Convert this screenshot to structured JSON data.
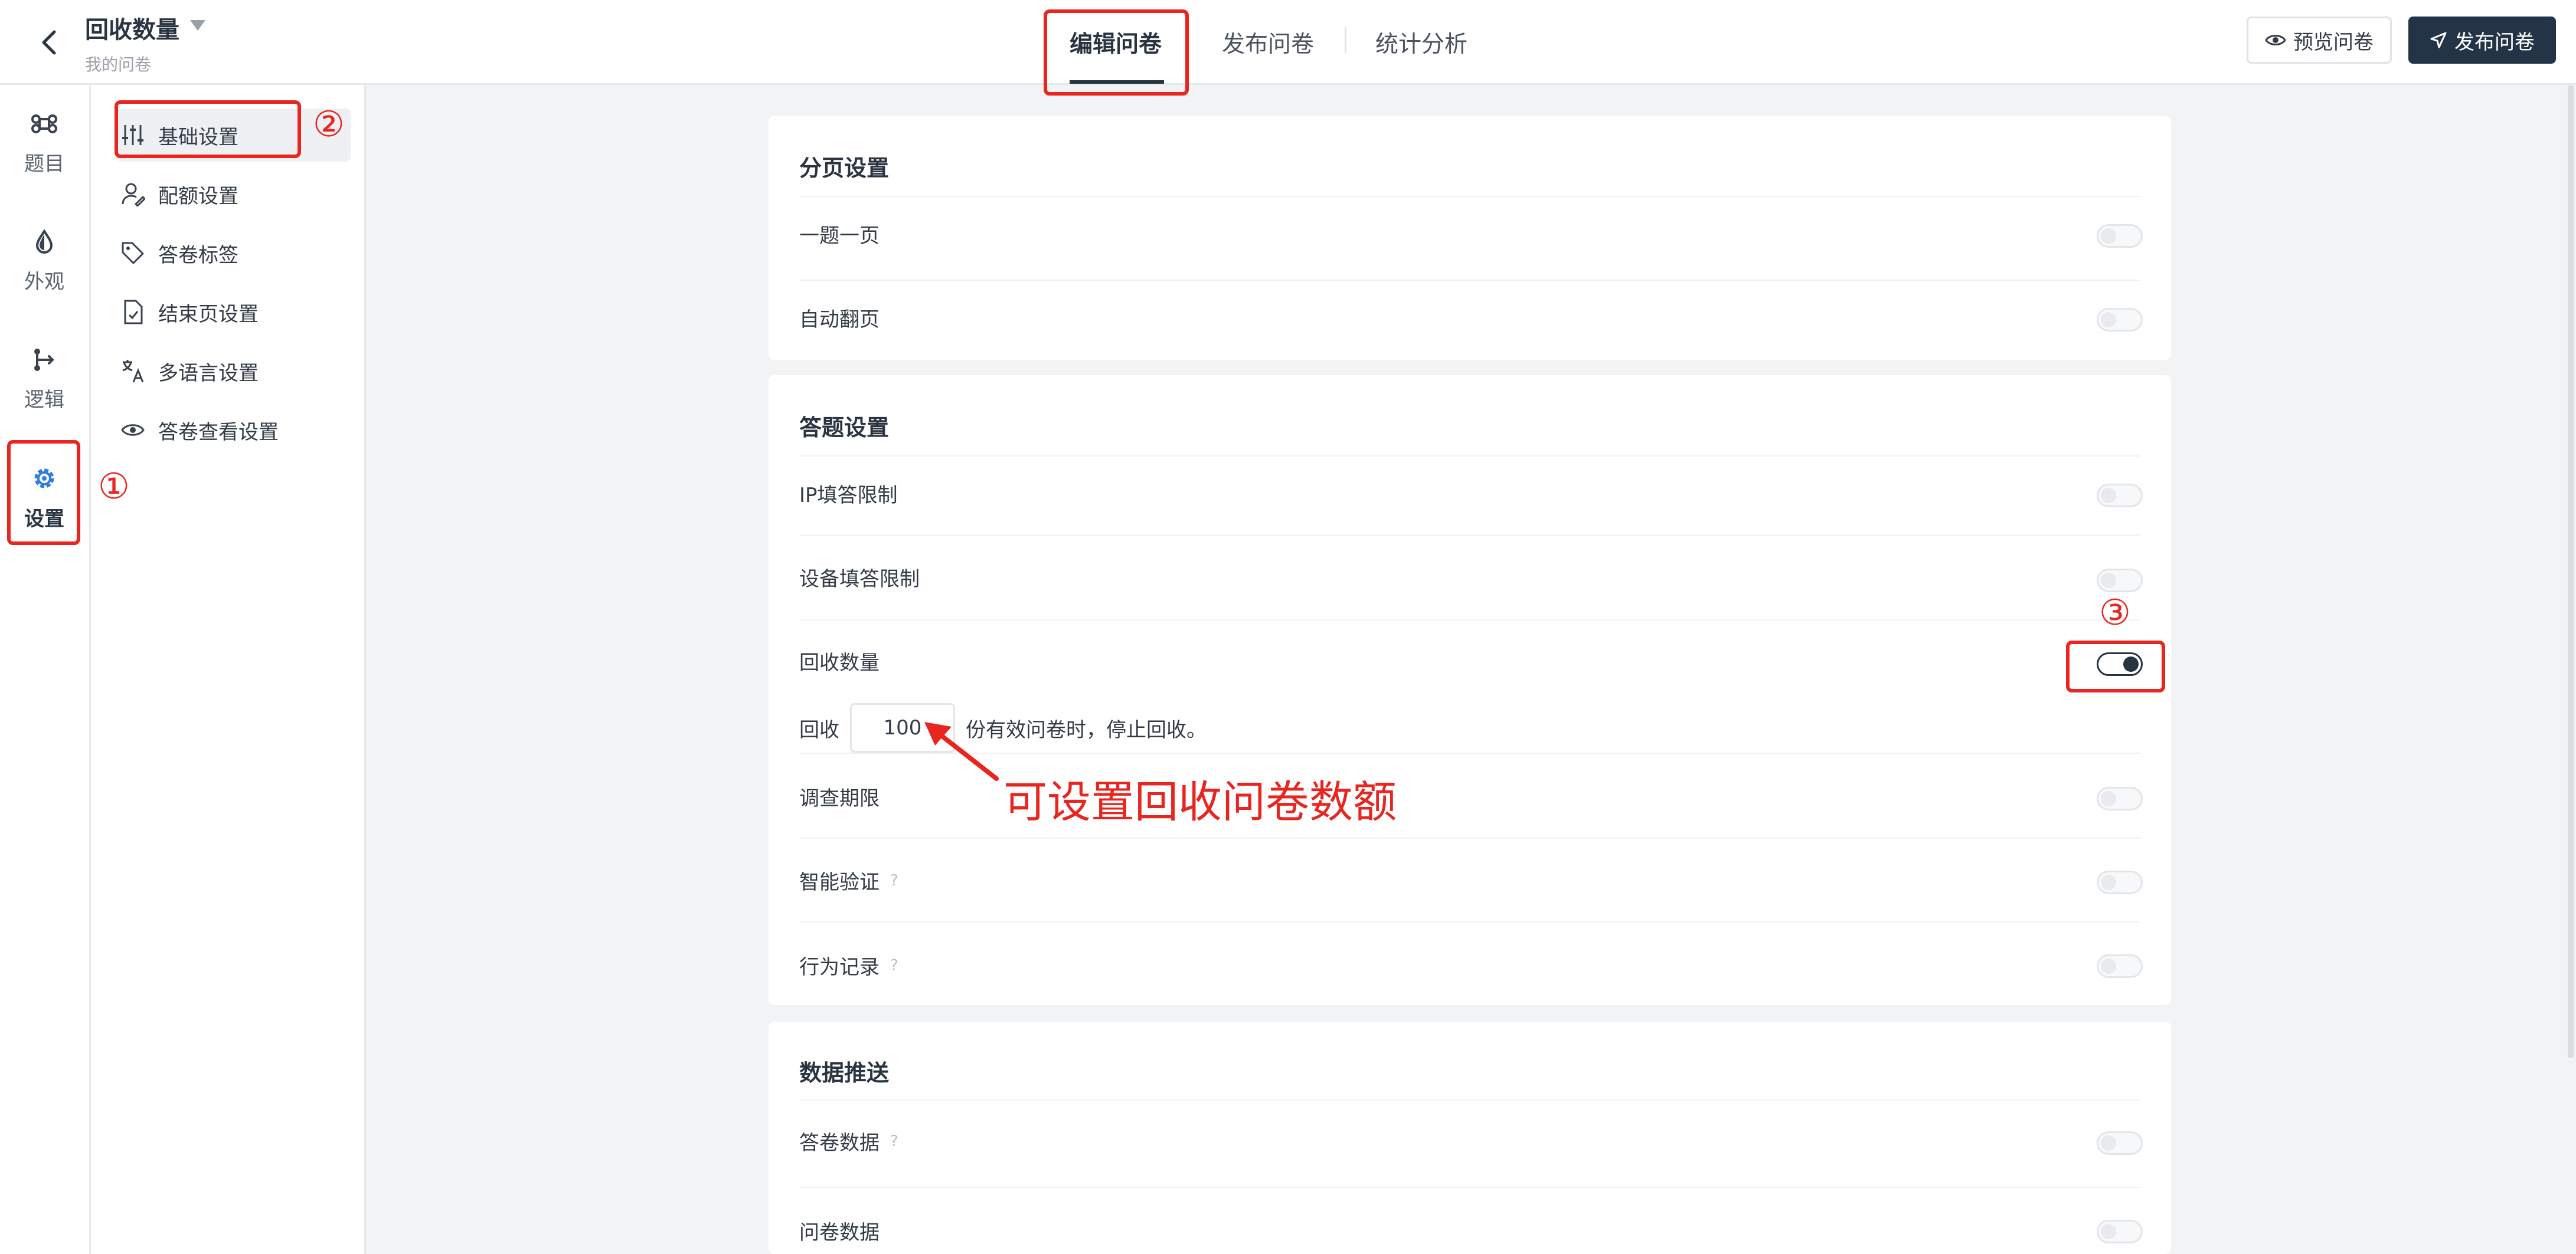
{
  "header": {
    "title": "回收数量",
    "subtitle": "我的问卷",
    "tabs": [
      {
        "label": "编辑问卷",
        "active": true
      },
      {
        "label": "发布问卷",
        "active": false
      },
      {
        "label": "统计分析",
        "active": false
      }
    ],
    "preview_label": "预览问卷",
    "publish_label": "发布问卷"
  },
  "rail": {
    "items": [
      {
        "label": "题目",
        "icon": "command-icon"
      },
      {
        "label": "外观",
        "icon": "drop-icon"
      },
      {
        "label": "逻辑",
        "icon": "logic-branch-icon"
      },
      {
        "label": "设置",
        "icon": "gear-icon",
        "active": true
      }
    ]
  },
  "subnav": {
    "items": [
      {
        "label": "基础设置",
        "icon": "sliders-icon",
        "active": true
      },
      {
        "label": "配额设置",
        "icon": "user-edit-icon"
      },
      {
        "label": "答卷标签",
        "icon": "tag-icon"
      },
      {
        "label": "结束页设置",
        "icon": "file-check-icon"
      },
      {
        "label": "多语言设置",
        "icon": "translate-icon"
      },
      {
        "label": "答卷查看设置",
        "icon": "eye-icon"
      }
    ]
  },
  "sections": {
    "paging": {
      "title": "分页设置",
      "rows": [
        {
          "label": "一题一页",
          "enabled": false
        },
        {
          "label": "自动翻页",
          "enabled": false
        }
      ]
    },
    "answering": {
      "title": "答题设置",
      "rows": [
        {
          "label": "IP填答限制",
          "enabled": false
        },
        {
          "label": "设备填答限制",
          "enabled": false
        },
        {
          "label": "回收数量",
          "enabled": true
        },
        {
          "label": "调查期限",
          "enabled": false
        },
        {
          "label": "智能验证",
          "enabled": false,
          "help": true
        },
        {
          "label": "行为记录",
          "enabled": false,
          "help": true
        }
      ],
      "quantity": {
        "prefix": "回收",
        "value": "100",
        "suffix": "份有效问卷时，停止回收。"
      }
    },
    "push": {
      "title": "数据推送",
      "rows": [
        {
          "label": "答卷数据",
          "enabled": false,
          "help": true
        },
        {
          "label": "问卷数据",
          "enabled": false
        }
      ]
    }
  },
  "annotations": {
    "step1": "①",
    "step2": "②",
    "step3": "③",
    "note": "可设置回收问卷数额",
    "color": "#e8251f"
  },
  "help_glyph": "?"
}
